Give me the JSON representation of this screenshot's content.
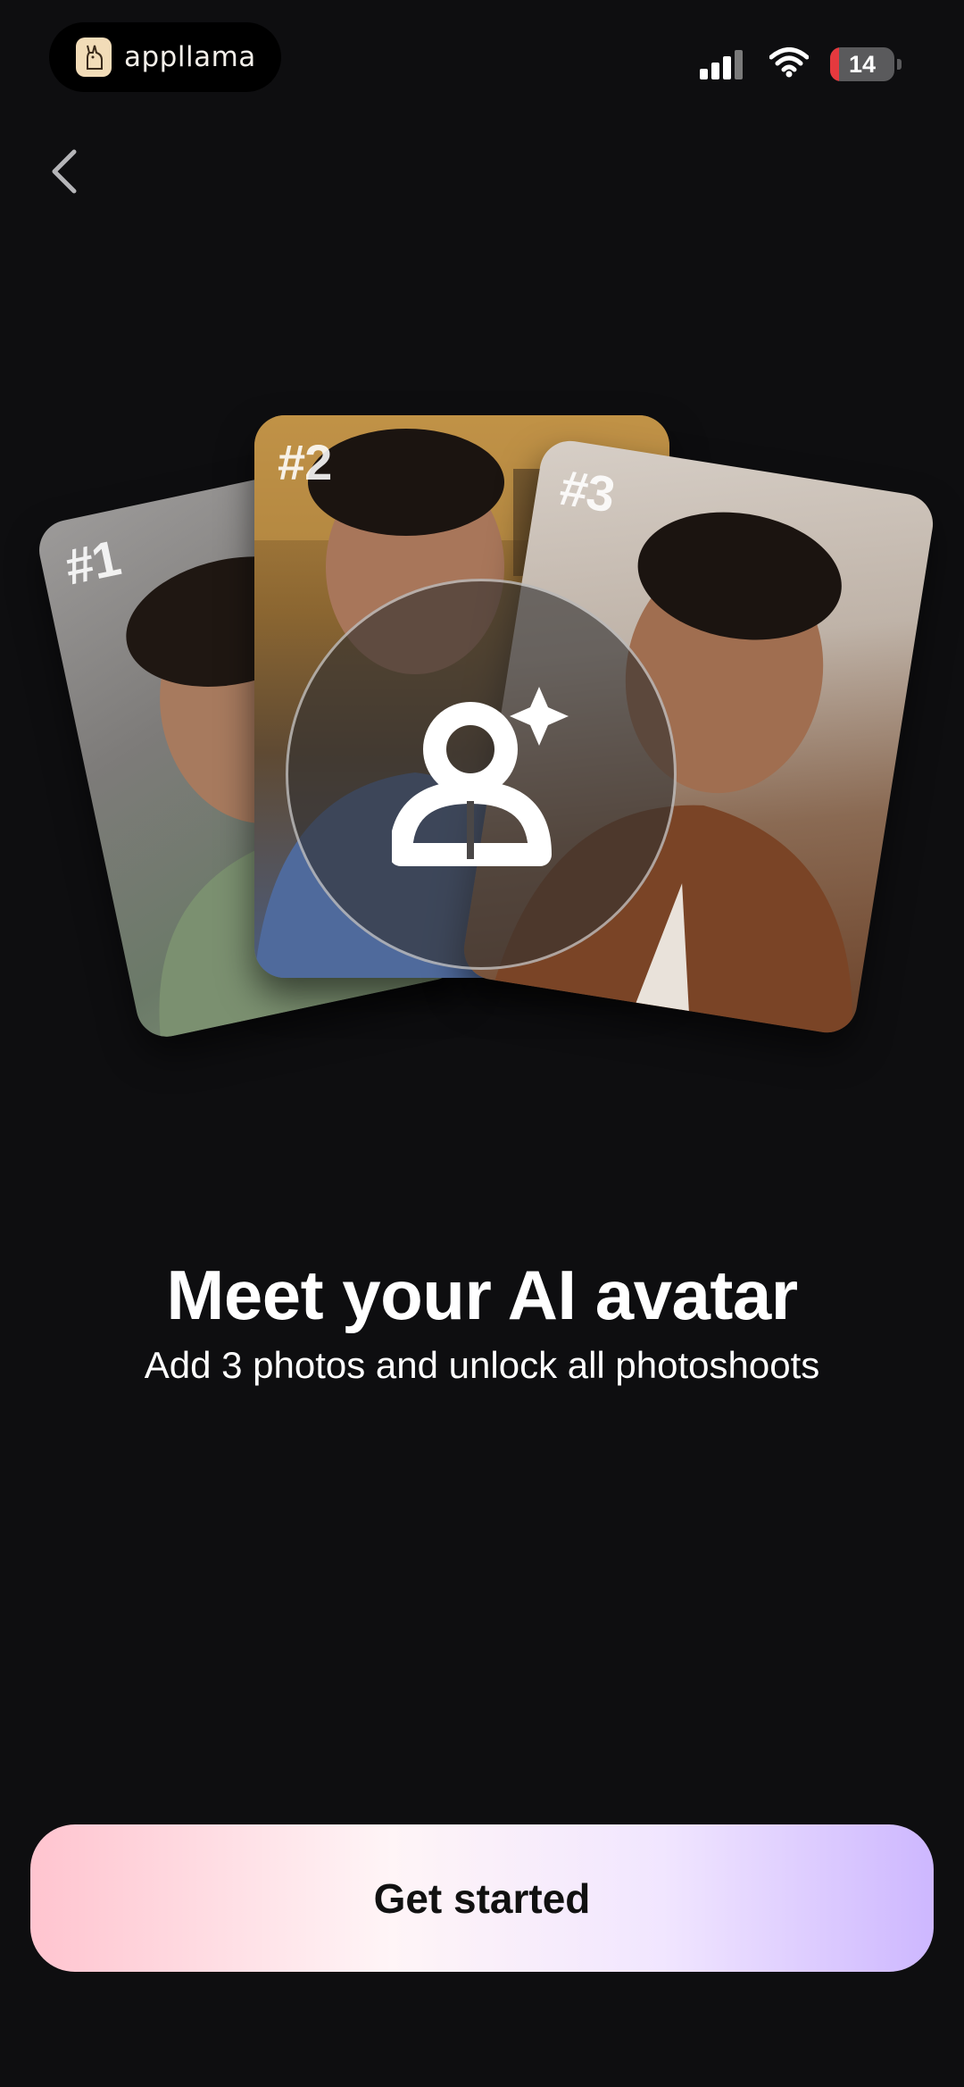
{
  "status_bar": {
    "brand_name": "appllama",
    "battery_level": "14",
    "battery_fraction": 0.14,
    "signal_icon": "cellular-signal-icon",
    "wifi_icon": "wifi-icon"
  },
  "nav": {
    "back_icon": "chevron-left-icon"
  },
  "cards": [
    {
      "label": "#1"
    },
    {
      "label": "#2"
    },
    {
      "label": "#3"
    }
  ],
  "avatar": {
    "icon": "ai-avatar-sparkle-icon"
  },
  "main": {
    "title": "Meet your AI avatar",
    "subtitle": "Add 3 photos and unlock all photoshoots"
  },
  "cta": {
    "label": "Get started"
  },
  "colors": {
    "background": "#0e0e10",
    "cta_gradient_start": "#ffc4cf",
    "cta_gradient_end": "#cdb7ff",
    "battery_low": "#e5393e"
  }
}
